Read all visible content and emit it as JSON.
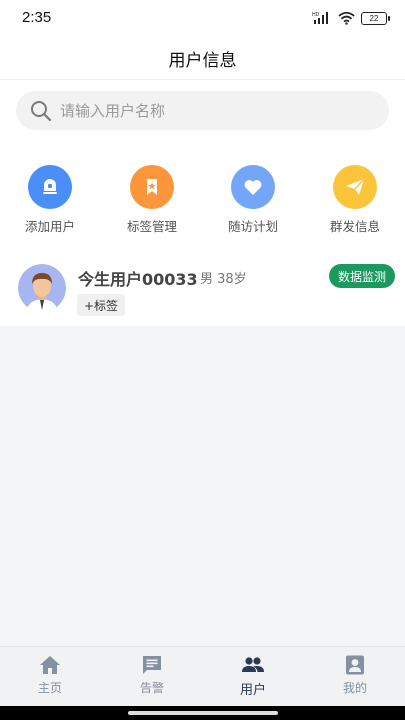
{
  "status": {
    "time": "2:35",
    "network": "HD",
    "battery": "22"
  },
  "header": {
    "title": "用户信息"
  },
  "search": {
    "placeholder": "请输入用户名称"
  },
  "actions": [
    {
      "label": "添加用户",
      "icon": "add-user-icon",
      "color": "#4b8ef7"
    },
    {
      "label": "标签管理",
      "icon": "tag-manage-icon",
      "color": "#fb963a"
    },
    {
      "label": "随访计划",
      "icon": "heart-icon",
      "color": "#74a6f7"
    },
    {
      "label": "群发信息",
      "icon": "send-icon",
      "color": "#fbc43a"
    }
  ],
  "users": [
    {
      "name": "今生用户00033",
      "info": "男 38岁",
      "monitor_label": "数据监测",
      "tag_label": "+标签"
    }
  ],
  "nav": {
    "items": [
      {
        "label": "主页",
        "icon": "home-icon"
      },
      {
        "label": "告警",
        "icon": "alert-message-icon"
      },
      {
        "label": "用户",
        "icon": "users-icon",
        "active": true
      },
      {
        "label": "我的",
        "icon": "profile-icon"
      }
    ]
  },
  "colors": {
    "accent": "#1b9a60",
    "nav_active": "#2b3a55",
    "nav_inactive": "#8590a0"
  }
}
